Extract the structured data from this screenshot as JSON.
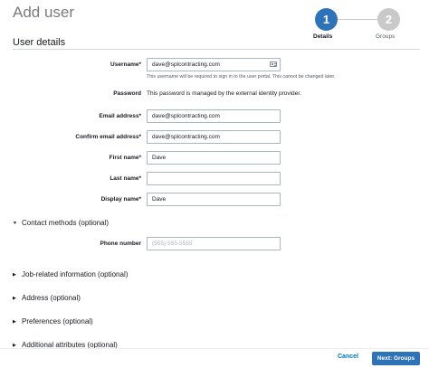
{
  "header": {
    "title": "Add user"
  },
  "stepper": {
    "steps": [
      {
        "number": "1",
        "label": "Details"
      },
      {
        "number": "2",
        "label": "Groups"
      }
    ]
  },
  "user_details": {
    "title": "User details",
    "username": {
      "label": "Username*",
      "value": "dave@splcontracting.com",
      "hint": "This username will be required to sign in to the user portal. This cannot be changed later."
    },
    "password": {
      "label": "Password",
      "text": "This password is managed by the external identity provider."
    },
    "email": {
      "label": "Email address*",
      "value": "dave@splcontracting.com"
    },
    "confirm_email": {
      "label": "Confirm email address*",
      "value": "dave@splcontracting.com"
    },
    "first_name": {
      "label": "First name*",
      "value": "Dave"
    },
    "last_name": {
      "label": "Last name*",
      "value": ""
    },
    "display_name": {
      "label": "Display name*",
      "value": "Dave"
    }
  },
  "contact_methods": {
    "title": "Contact methods (optional)",
    "phone": {
      "label": "Phone number",
      "placeholder": "(555) 555-5555"
    }
  },
  "collapsed_sections": [
    "Job-related information (optional)",
    "Address (optional)",
    "Preferences (optional)",
    "Additional attributes (optional)"
  ],
  "footer": {
    "cancel_label": "Cancel",
    "next_label": "Next: Groups"
  }
}
